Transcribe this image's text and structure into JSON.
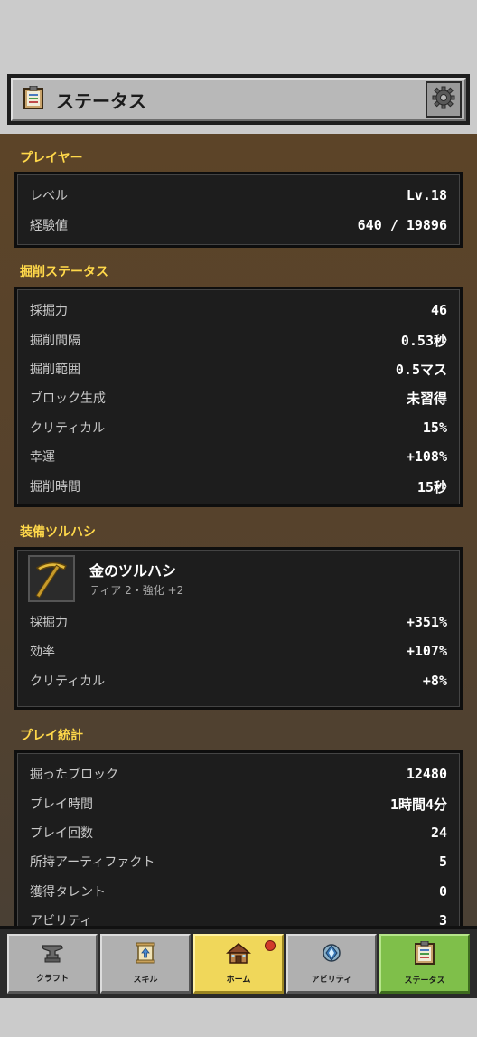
{
  "header": {
    "title": "ステータス",
    "icon": "clipboard-icon",
    "settings_icon": "gear-icon"
  },
  "player": {
    "section_title": "プレイヤー",
    "rows": [
      {
        "label": "レベル",
        "value": "Lv.18"
      },
      {
        "label": "経験値",
        "value": "640 / 19896"
      }
    ]
  },
  "mining": {
    "section_title": "掘削ステータス",
    "rows": [
      {
        "label": "採掘力",
        "value": "46"
      },
      {
        "label": "掘削間隔",
        "value": "0.53秒"
      },
      {
        "label": "掘削範囲",
        "value": "0.5マス"
      },
      {
        "label": "ブロック生成",
        "value": "未習得"
      },
      {
        "label": "クリティカル",
        "value": "15%"
      },
      {
        "label": "幸運",
        "value": "+108%"
      },
      {
        "label": "掘削時間",
        "value": "15秒"
      }
    ]
  },
  "pickaxe": {
    "section_title": "装備ツルハシ",
    "name": "金のツルハシ",
    "subtitle": "ティア 2・強化 +2",
    "icon": "gold-pickaxe-icon",
    "rows": [
      {
        "label": "採掘力",
        "value": "+351%"
      },
      {
        "label": "効率",
        "value": "+107%"
      },
      {
        "label": "クリティカル",
        "value": "+8%"
      }
    ]
  },
  "stats": {
    "section_title": "プレイ統計",
    "rows": [
      {
        "label": "掘ったブロック",
        "value": "12480"
      },
      {
        "label": "プレイ時間",
        "value": "1時間4分"
      },
      {
        "label": "プレイ回数",
        "value": "24"
      },
      {
        "label": "所持アーティファクト",
        "value": "5"
      },
      {
        "label": "獲得タレント",
        "value": "0"
      },
      {
        "label": "アビリティ",
        "value": "3"
      }
    ]
  },
  "nav": {
    "items": [
      {
        "label": "クラフト",
        "icon": "anvil-icon"
      },
      {
        "label": "スキル",
        "icon": "scroll-icon"
      },
      {
        "label": "ホーム",
        "icon": "house-icon",
        "has_badge": true
      },
      {
        "label": "アビリティ",
        "icon": "gem-icon"
      },
      {
        "label": "ステータス",
        "icon": "clipboard-icon",
        "active": true
      }
    ]
  },
  "colors": {
    "accent_yellow": "#ffd84a",
    "active_green": "#7fbf4a",
    "home_yellow": "#f0d75a",
    "badge_red": "#d23a2a"
  }
}
